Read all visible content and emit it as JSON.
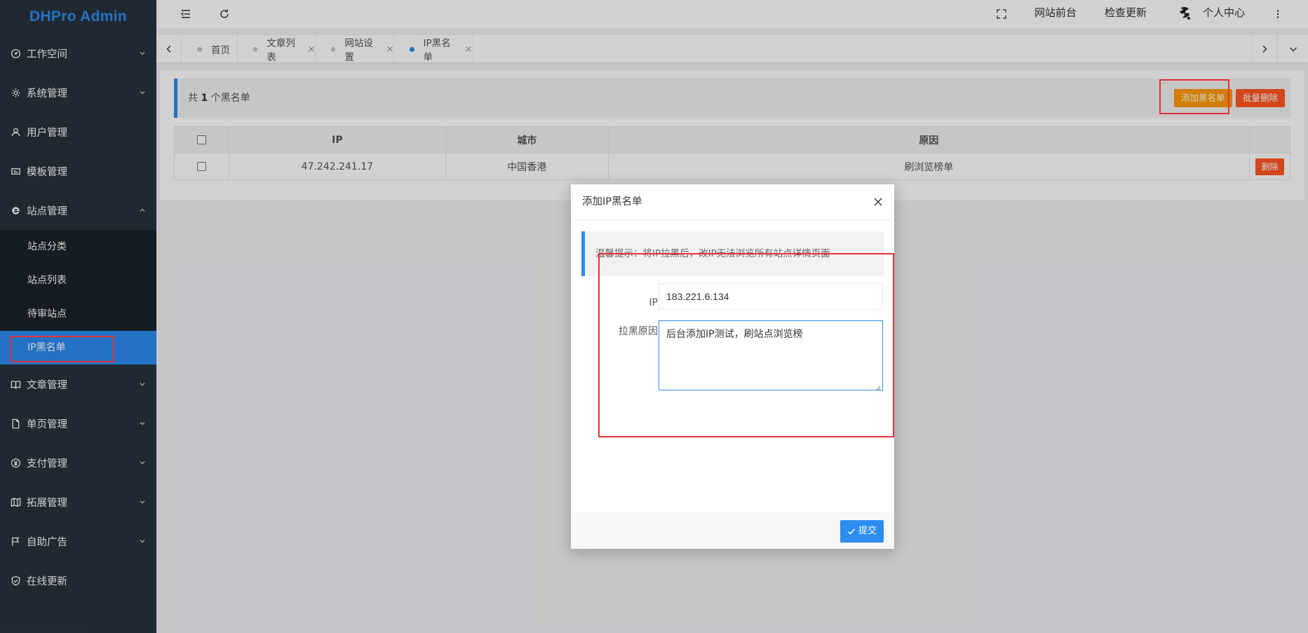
{
  "app": {
    "logo": "DHPro Admin"
  },
  "sidebar": {
    "items": [
      {
        "label": "工作空间",
        "icon": "dashboard-icon"
      },
      {
        "label": "系统管理",
        "icon": "gear-icon"
      },
      {
        "label": "用户管理",
        "icon": "user-icon"
      },
      {
        "label": "模板管理",
        "icon": "template-icon"
      },
      {
        "label": "站点管理",
        "icon": "ie-icon",
        "expanded": true
      },
      {
        "label": "文章管理",
        "icon": "book-icon"
      },
      {
        "label": "单页管理",
        "icon": "file-icon"
      },
      {
        "label": "支付管理",
        "icon": "yen-icon"
      },
      {
        "label": "拓展管理",
        "icon": "map-icon"
      },
      {
        "label": "自助广告",
        "icon": "flag-icon"
      },
      {
        "label": "在线更新",
        "icon": "shield-check-icon"
      }
    ],
    "sub_items": [
      {
        "label": "站点分类"
      },
      {
        "label": "站点列表"
      },
      {
        "label": "待审站点"
      },
      {
        "label": "IP黑名单",
        "active": true
      }
    ]
  },
  "header": {
    "front_link": "网站前台",
    "update_link": "检查更新",
    "user_center": "个人中心"
  },
  "tabs": [
    {
      "label": "首页",
      "closable": false
    },
    {
      "label": "文章列表",
      "closable": true
    },
    {
      "label": "网站设置",
      "closable": true
    },
    {
      "label": "IP黑名单",
      "closable": true,
      "active": true
    }
  ],
  "toolbar": {
    "prefix": "共",
    "count": "1",
    "suffix": "个黑名单",
    "add_button": "添加黑名单",
    "batch_delete_button": "批量删除"
  },
  "table": {
    "headers": [
      "IP",
      "城市",
      "原因"
    ],
    "rows": [
      {
        "ip": "47.242.241.17",
        "city": "中国香港",
        "reason": "刷浏览榜单",
        "action": "删除"
      }
    ]
  },
  "modal": {
    "title": "添加IP黑名单",
    "tip": "温馨提示：将IP拉黑后，改IP无法浏览所有站点详情页面",
    "ip_label": "IP",
    "ip_value": "183.221.6.134",
    "reason_label": "拉黑原因",
    "reason_value": "后台添加IP测试，刷站点浏览榜",
    "submit_label": "提交"
  },
  "colors": {
    "sidebar_bg": "#28333e",
    "submenu_bg": "#1a232b",
    "accent": "#2d8cf0",
    "orange": "#ff9900",
    "danger": "#ff5722",
    "annotation": "#e53238"
  }
}
